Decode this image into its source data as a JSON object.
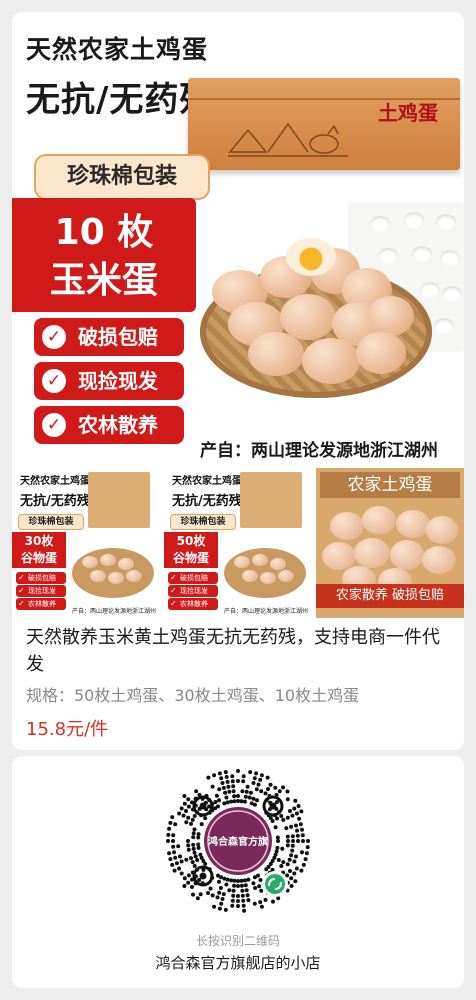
{
  "hero": {
    "title_line1": "天然农家土鸡蛋",
    "title_line2": "无抗/无药残",
    "box_seal": "土鸡蛋",
    "packaging_label": "珍珠棉包装",
    "count_label": "10 枚",
    "type_label": "玉米蛋",
    "badges": [
      "破损包赔",
      "现捡现发",
      "农林散养"
    ],
    "origin": "产自：两山理论发源地浙江湖州"
  },
  "thumbnails": [
    {
      "title1": "天然农家土鸡蛋",
      "title2": "无抗/无药残",
      "pearl": "珍珠棉包装",
      "count": "30枚",
      "type": "谷物蛋",
      "badges": [
        "破损包赔",
        "现捡现发",
        "农林散养"
      ],
      "origin": "产自：两山理论发源地浙江湖州"
    },
    {
      "title1": "天然农家土鸡蛋",
      "title2": "无抗/无药残",
      "pearl": "珍珠棉包装",
      "count": "50枚",
      "type": "谷物蛋",
      "badges": [
        "破损包赔",
        "现捡现发",
        "农林散养"
      ],
      "origin": "产自：两山理论发源地浙江湖州"
    },
    {
      "top_caption": "农家土鸡蛋",
      "bottom_caption": "农家散养  破损包赔"
    }
  ],
  "product": {
    "title": "天然散养玉米黄土鸡蛋无抗无药残，支持电商一件代发",
    "spec": "规格：50枚土鸡蛋、30枚土鸡蛋、10枚土鸡蛋",
    "price": "15.8元/件"
  },
  "shop": {
    "qr_center_text": "鸿合森官方旗",
    "qr_hint": "长按识别二维码",
    "name": "鸿合森官方旗舰店的小店"
  },
  "colors": {
    "accent_red": "#d01a1a",
    "price_red": "#e02e24",
    "qr_purple": "#7a2a5a",
    "wechat_green": "#2aae67"
  }
}
